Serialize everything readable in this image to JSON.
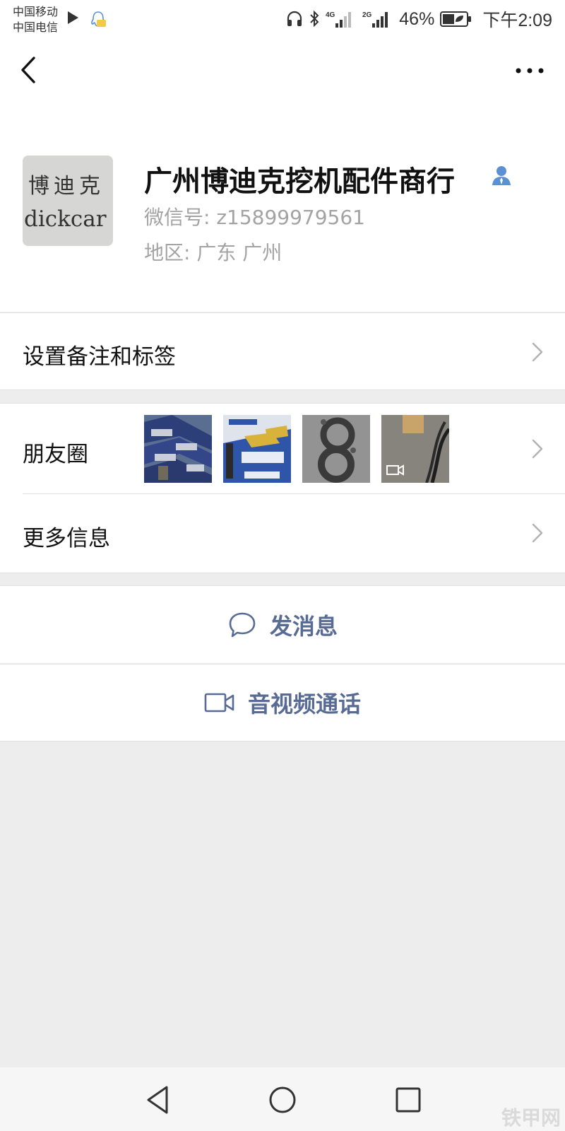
{
  "status_bar": {
    "carrier_1": "中国移动",
    "carrier_2": "中国电信",
    "network_1": "4G",
    "network_2": "2G",
    "battery": "46%",
    "time": "下午2:09"
  },
  "profile": {
    "avatar_text_1": "博迪克",
    "avatar_text_2": "dickcar",
    "name": "广州博迪克挖机配件商行",
    "wechat_id": "微信号:  z15899979561",
    "region": "地区:  广东  广州"
  },
  "rows": {
    "remark": "设置备注和标签",
    "moments": "朋友圈",
    "more_info": "更多信息"
  },
  "actions": {
    "send_message": "发消息",
    "av_call": "音视频通话"
  },
  "colors": {
    "link_blue": "#576b95",
    "verify_blue": "#5b8fd6",
    "background": "#ededed"
  },
  "watermark": "铁甲网"
}
